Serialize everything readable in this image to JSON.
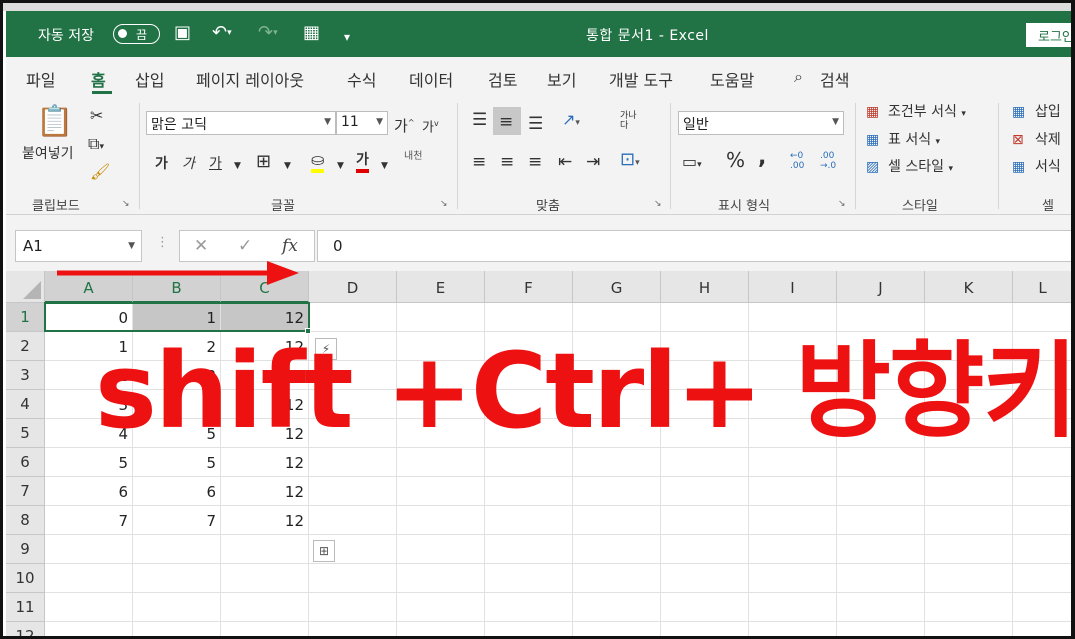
{
  "window": {
    "autosave_label": "자동 저장",
    "autosave_state": "끔",
    "title": "통합 문서1  -  Excel",
    "login_label": "로그인"
  },
  "tabs": [
    "파일",
    "홈",
    "삽입",
    "페이지 레이아웃",
    "수식",
    "데이터",
    "검토",
    "보기",
    "개발 도구",
    "도움말"
  ],
  "active_tab": "홈",
  "search_label": "검색",
  "ribbon": {
    "clipboard": {
      "paste_label": "붙여넣기",
      "group_label": "클립보드"
    },
    "font": {
      "font_name": "맑은 고딕",
      "font_size": "11",
      "grow_label": "가",
      "shrink_label": "가",
      "bold_label": "가",
      "italic_label": "가",
      "underline_label": "가",
      "color_label": "가",
      "phonetic_label": "내천",
      "group_label": "글꼴"
    },
    "alignment": {
      "wrap_label": "가나다",
      "group_label": "맞춤"
    },
    "number": {
      "format": "일반",
      "group_label": "표시 형식"
    },
    "styles": {
      "conditional": "조건부 서식",
      "table": "표 서식",
      "cell_style": "셀 스타일",
      "group_label": "스타일"
    },
    "cells": {
      "insert": "삽입",
      "delete": "삭제",
      "format": "서식",
      "group_label": "셀"
    }
  },
  "formula_bar": {
    "name_box": "A1",
    "value": "0",
    "fx": "fx"
  },
  "grid": {
    "columns": [
      "A",
      "B",
      "C",
      "D",
      "E",
      "F",
      "G",
      "H",
      "I",
      "J",
      "K",
      "L"
    ],
    "rows": [
      "1",
      "2",
      "3",
      "4",
      "5",
      "6",
      "7",
      "8",
      "9",
      "10",
      "11",
      "12"
    ],
    "cells": [
      [
        "0",
        "1",
        "12"
      ],
      [
        "1",
        "2",
        "12"
      ],
      [
        "2",
        "3",
        "12"
      ],
      [
        "3",
        "4",
        "12"
      ],
      [
        "4",
        "5",
        "12"
      ],
      [
        "5",
        "5",
        "12"
      ],
      [
        "6",
        "6",
        "12"
      ],
      [
        "7",
        "7",
        "12"
      ]
    ]
  },
  "overlay": {
    "caption": "shift +Ctrl+ 방향키",
    "accent": "#ee1111"
  },
  "colors": {
    "excel_green": "#217346"
  }
}
